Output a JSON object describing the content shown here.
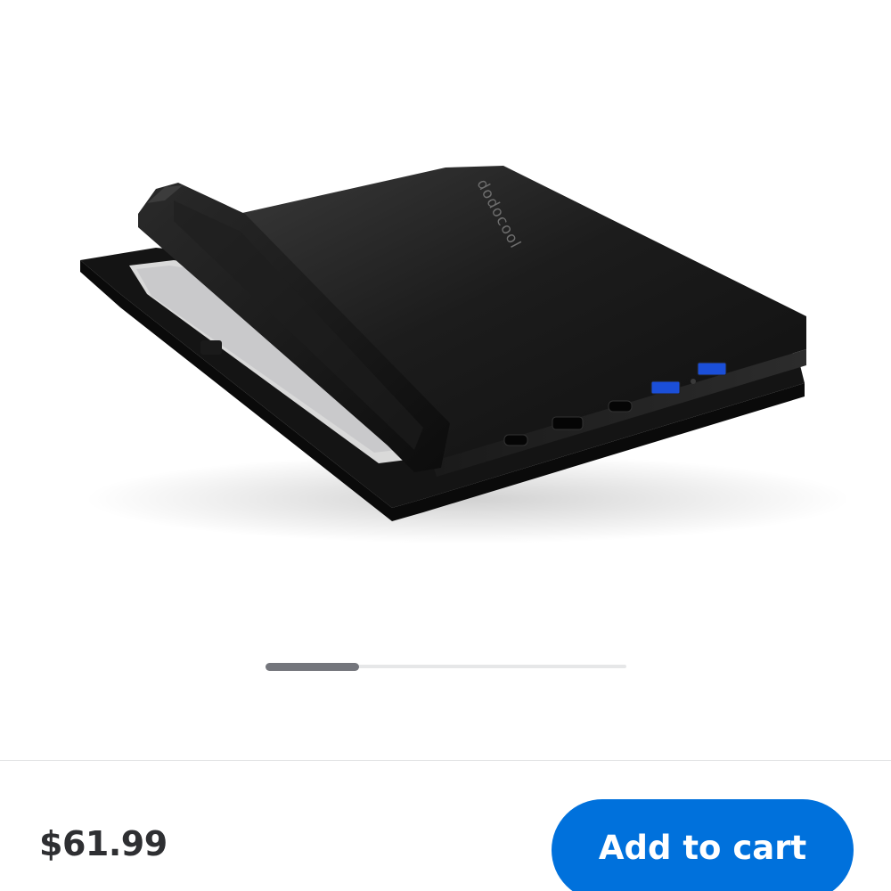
{
  "product": {
    "image_name": "black tablet keyboard case with ports",
    "brand_mark": "dodocool"
  },
  "gallery": {
    "scroll_position": 0.26
  },
  "purchase_bar": {
    "price": "$61.99",
    "add_to_cart_label": "Add to cart",
    "button_color": "#0071dc"
  }
}
